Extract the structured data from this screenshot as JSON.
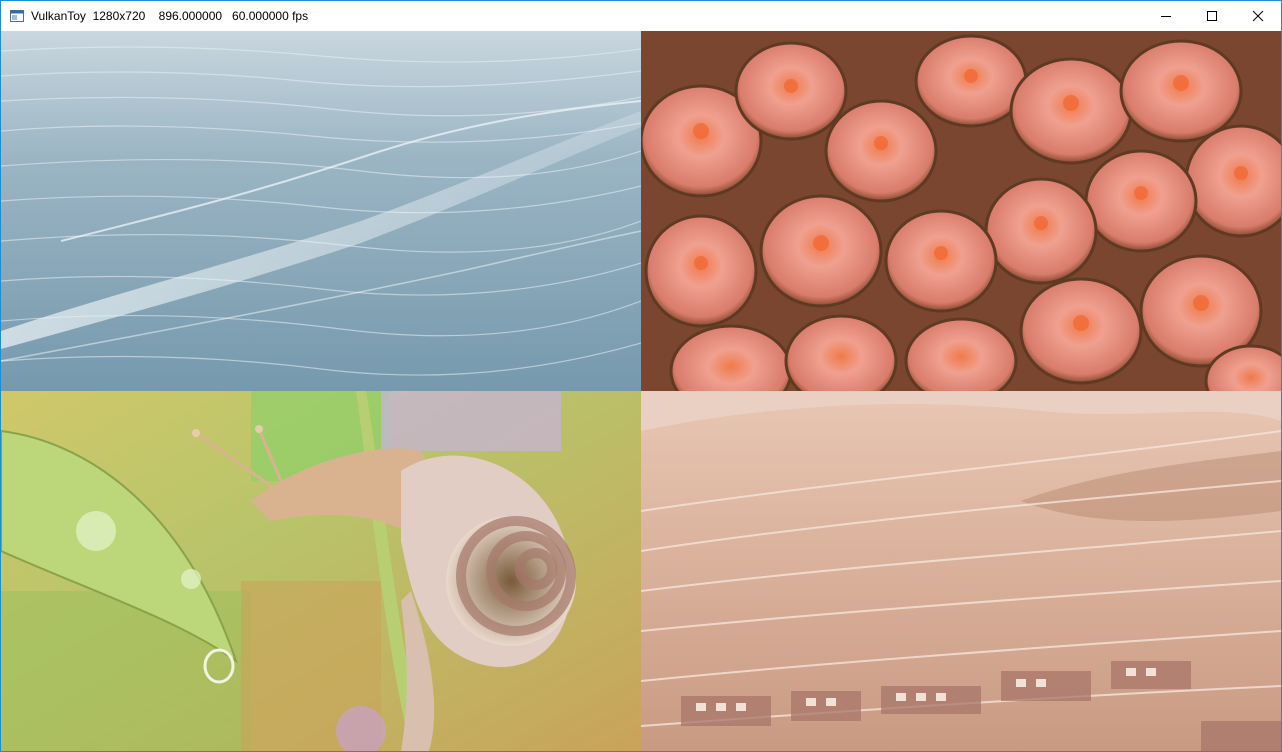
{
  "window": {
    "title": "VulkanToy  1280x720    896.000000   60.000000 fps",
    "app_icon": "window-app-icon",
    "buttons": {
      "minimize": "minimize-icon",
      "maximize": "maximize-icon",
      "close": "close-icon"
    }
  },
  "viewport": {
    "quadrants": [
      {
        "id": "ocean",
        "scene": "ocean-waves-render",
        "accent": "#7fa3b8"
      },
      {
        "id": "cells",
        "scene": "organic-cells-render",
        "accent": "#e07a5a"
      },
      {
        "id": "snail",
        "scene": "snail-on-stem-render",
        "accent": "#c9b36a"
      },
      {
        "id": "city",
        "scene": "sandstone-city-render",
        "accent": "#d9b3a0"
      }
    ]
  }
}
